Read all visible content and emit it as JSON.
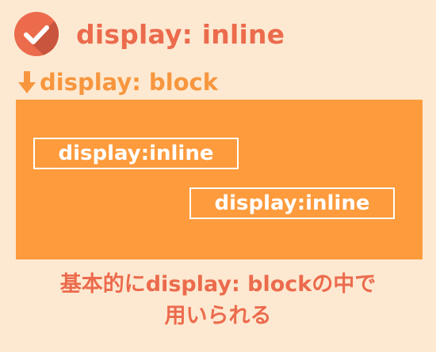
{
  "header": {
    "title": "display: inline",
    "icon": "check-circle-icon"
  },
  "subheader": {
    "icon": "arrow-down-icon",
    "text": "display: block"
  },
  "diagram": {
    "inline_box_1": "display:inline",
    "inline_box_2": "display:inline"
  },
  "caption": {
    "line1": "基本的にdisplay: blockの中で",
    "line2": "用いられる"
  },
  "colors": {
    "background": "#fde9d1",
    "title": "#ec6b4d",
    "subheader": "#f7963e",
    "block": "#fd9b3d",
    "inline_border": "#ffffff"
  }
}
